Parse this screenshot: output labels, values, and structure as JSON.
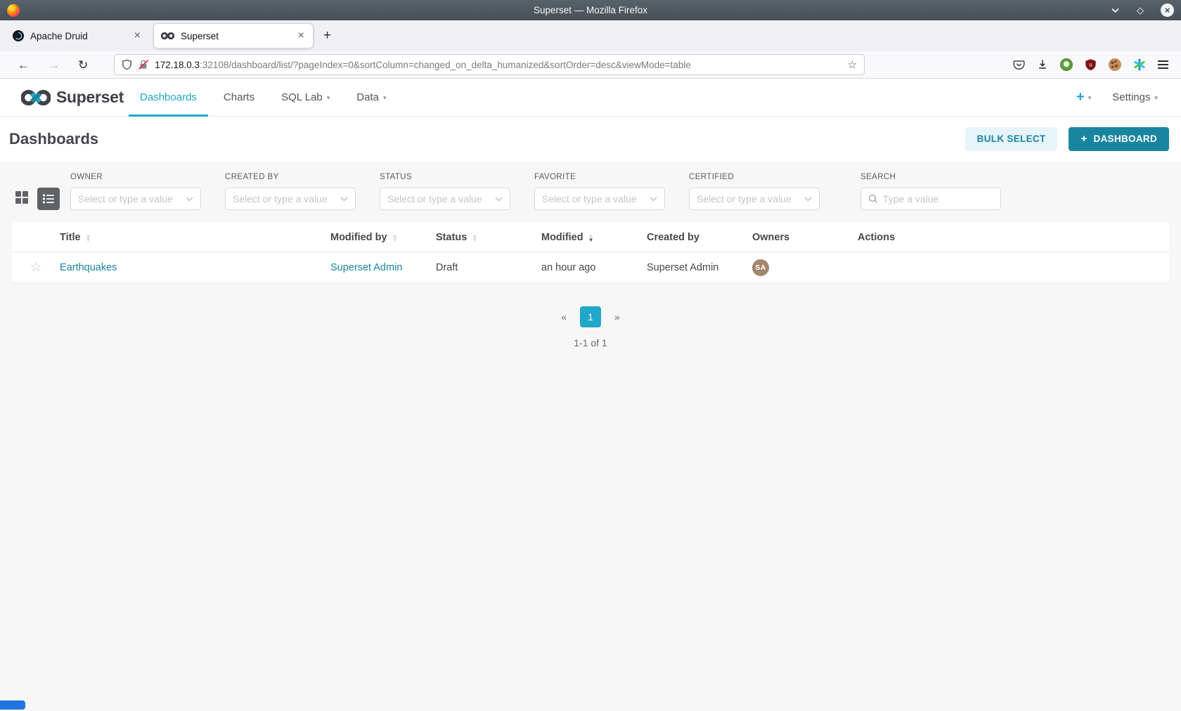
{
  "window": {
    "title": "Superset — Mozilla Firefox"
  },
  "browser": {
    "tabs": [
      {
        "title": "Apache Druid",
        "active": false
      },
      {
        "title": "Superset",
        "active": true
      }
    ],
    "url": {
      "host": "172.18.0.3",
      "rest": ":32108/dashboard/list/?pageIndex=0&sortColumn=changed_on_delta_humanized&sortOrder=desc&viewMode=table"
    }
  },
  "nav": {
    "brand": "Superset",
    "items": [
      {
        "label": "Dashboards"
      },
      {
        "label": "Charts"
      },
      {
        "label": "SQL Lab"
      },
      {
        "label": "Data"
      }
    ],
    "right": {
      "plus": "+",
      "settings": "Settings"
    }
  },
  "page": {
    "title": "Dashboards",
    "bulk_select_label": "BULK SELECT",
    "add_dashboard_label": "DASHBOARD"
  },
  "filters": {
    "items": [
      {
        "label": "OWNER",
        "placeholder": "Select or type a value"
      },
      {
        "label": "CREATED BY",
        "placeholder": "Select or type a value"
      },
      {
        "label": "STATUS",
        "placeholder": "Select or type a value"
      },
      {
        "label": "FAVORITE",
        "placeholder": "Select or type a value"
      },
      {
        "label": "CERTIFIED",
        "placeholder": "Select or type a value"
      },
      {
        "label": "SEARCH",
        "placeholder": "Type a value"
      }
    ]
  },
  "table": {
    "columns": [
      {
        "label": "Title",
        "sortable": true
      },
      {
        "label": "Modified by",
        "sortable": true
      },
      {
        "label": "Status",
        "sortable": true
      },
      {
        "label": "Modified",
        "sortable": true,
        "sorted": "desc"
      },
      {
        "label": "Created by",
        "sortable": false
      },
      {
        "label": "Owners",
        "sortable": false
      },
      {
        "label": "Actions",
        "sortable": false
      }
    ],
    "rows": [
      {
        "title": "Earthquakes",
        "modified_by": "Superset Admin",
        "status": "Draft",
        "modified": "an hour ago",
        "created_by": "Superset Admin",
        "owner_initials": "SA"
      }
    ]
  },
  "pagination": {
    "prev": "«",
    "page": "1",
    "next": "»",
    "summary": "1-1 of 1"
  },
  "colors": {
    "primary": "#20A7C9",
    "primary_dark": "#1A85A0",
    "link": "#1985A0",
    "content_bg": "#F7F7F7",
    "avatar_bg": "#A1886D",
    "titlebar": "#4E565E"
  }
}
